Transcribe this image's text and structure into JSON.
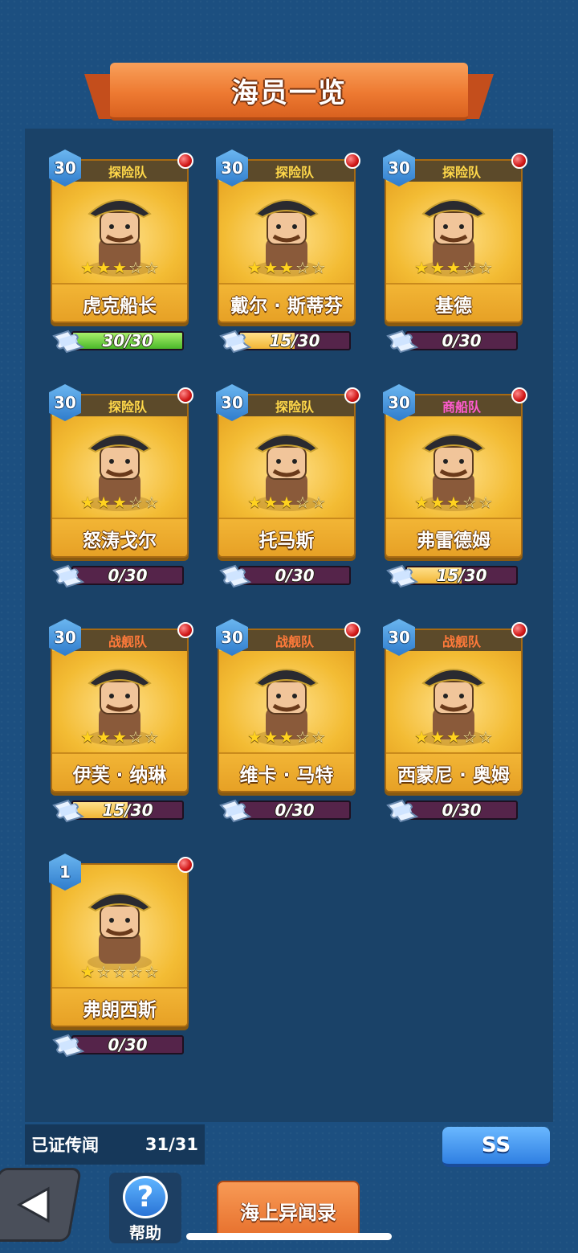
{
  "header": {
    "title": "海员一览"
  },
  "crew": [
    {
      "level": "30",
      "faction": "探险队",
      "faction_color": "#ffd84a",
      "name": "虎克船长",
      "stars": 3,
      "progress_text": "30/30",
      "progress": 1.0,
      "portrait": "captain-hook-portrait"
    },
    {
      "level": "30",
      "faction": "探险队",
      "faction_color": "#ffd84a",
      "name": "戴尔 · 斯蒂芬",
      "stars": 3,
      "progress_text": "15/30",
      "progress": 0.5,
      "portrait": "pirate-hat-portrait"
    },
    {
      "level": "30",
      "faction": "探险队",
      "faction_color": "#ffd84a",
      "name": "基德",
      "stars": 3,
      "progress_text": "0/30",
      "progress": 0,
      "portrait": "crowned-king-portrait"
    },
    {
      "level": "30",
      "faction": "探险队",
      "faction_color": "#ffd84a",
      "name": "怒涛戈尔",
      "stars": 3,
      "progress_text": "0/30",
      "progress": 0,
      "portrait": "sea-monster-portrait"
    },
    {
      "level": "30",
      "faction": "探险队",
      "faction_color": "#ffd84a",
      "name": "托马斯",
      "stars": 3,
      "progress_text": "0/30",
      "progress": 0,
      "portrait": "skull-hat-pirate-portrait"
    },
    {
      "level": "30",
      "faction": "商船队",
      "faction_color": "#ff5bd0",
      "name": "弗雷德姆",
      "stars": 3,
      "progress_text": "15/30",
      "progress": 0.5,
      "portrait": "old-merchant-portrait"
    },
    {
      "level": "30",
      "faction": "战舰队",
      "faction_color": "#ff7a3a",
      "name": "伊芙 · 纳琳",
      "stars": 3,
      "progress_text": "15/30",
      "progress": 0.5,
      "portrait": "explorer-girl-portrait"
    },
    {
      "level": "30",
      "faction": "战舰队",
      "faction_color": "#ff7a3a",
      "name": "维卡 · 马特",
      "stars": 3,
      "progress_text": "0/30",
      "progress": 0,
      "portrait": "warrior-girl-portrait"
    },
    {
      "level": "30",
      "faction": "战舰队",
      "faction_color": "#ff7a3a",
      "name": "西蒙尼 · 奥姆",
      "stars": 3,
      "progress_text": "0/30",
      "progress": 0,
      "portrait": "old-admiral-portrait"
    },
    {
      "level": "1",
      "faction": "",
      "faction_color": "#ffd84a",
      "name": "弗朗西斯",
      "stars": 1,
      "progress_text": "0/30",
      "progress": 0,
      "portrait": "bearded-pirate-portrait"
    }
  ],
  "footer": {
    "legend_label": "已证传闻",
    "legend_count": "31/31",
    "ss_label": "SS",
    "help_label": "帮助",
    "help_icon": "?",
    "log_label": "海上异闻录"
  },
  "colors": {
    "card": "#f0b12a",
    "panel": "#1a4268",
    "banner": "#ee7a32"
  }
}
